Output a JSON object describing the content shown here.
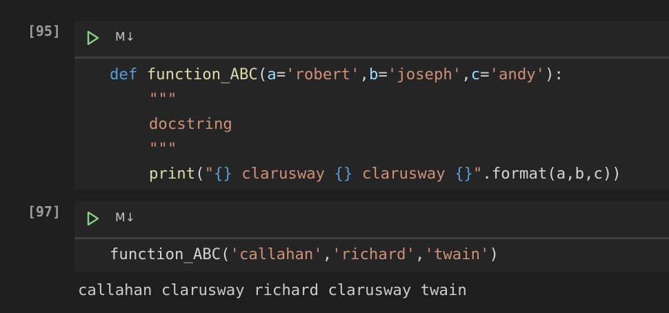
{
  "cells": [
    {
      "execution_count": "[95]",
      "cell_kind_label": "M↓",
      "code": {
        "line1": {
          "kw": "def",
          "fn_name": "function_ABC",
          "open": "(",
          "p1": "a",
          "eq1": "=",
          "s1": "'robert'",
          "c1": ",",
          "p2": "b",
          "eq2": "=",
          "s2": "'joseph'",
          "c2": ",",
          "p3": "c",
          "eq3": "=",
          "s3": "'andy'",
          "close": "):"
        },
        "doc_open": "\"\"\"",
        "doc_text": "docstring",
        "doc_close": "\"\"\"",
        "line5": {
          "fn": "print",
          "open": "(",
          "q1": "\"",
          "b1": "{}",
          "t1": " clarusway ",
          "b2": "{}",
          "t2": " clarusway ",
          "b3": "{}",
          "q2": "\"",
          "rest": ".format(a,b,c))"
        }
      }
    },
    {
      "execution_count": "[97]",
      "cell_kind_label": "M↓",
      "code": {
        "fn": "function_ABC",
        "open": "(",
        "s1": "'callahan'",
        "c1": ",",
        "s2": "'richard'",
        "c2": ",",
        "s3": "'twain'",
        "close": ")"
      },
      "output": "callahan clarusway richard clarusway twain"
    }
  ],
  "icons": {
    "run": "play-icon"
  },
  "colors": {
    "background": "#1e1e1e",
    "cell_background": "#252526",
    "run_icon": "#89d185",
    "keyword": "#569cd6",
    "function": "#dcdcaa",
    "parameter": "#9cdcfe",
    "string": "#ce9178"
  }
}
